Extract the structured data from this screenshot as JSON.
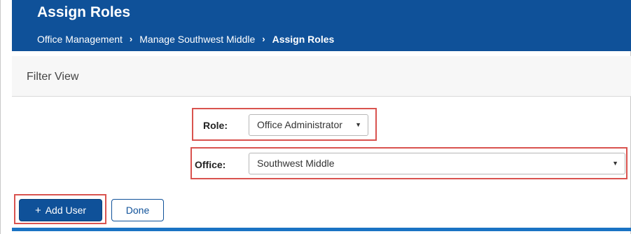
{
  "header": {
    "title": "Assign Roles",
    "breadcrumb": {
      "item1": "Office Management",
      "item2": "Manage Southwest Middle",
      "item3": "Assign Roles",
      "separator": "›"
    }
  },
  "filter": {
    "title": "Filter View",
    "role": {
      "label": "Role:",
      "value": "Office Administrator"
    },
    "office": {
      "label": "Office:",
      "value": "Southwest Middle"
    },
    "dropdown_arrow": "▼"
  },
  "actions": {
    "add_user_icon": "+",
    "add_user_label": "Add User",
    "done_label": "Done"
  },
  "colors": {
    "header_bg": "#0f5199",
    "highlight": "#d9534f",
    "bottom_bar": "#1a73c4"
  },
  "icons": {
    "breadcrumb_separator": "chevron-right-icon",
    "dropdown": "caret-down-icon",
    "add": "plus-icon"
  }
}
